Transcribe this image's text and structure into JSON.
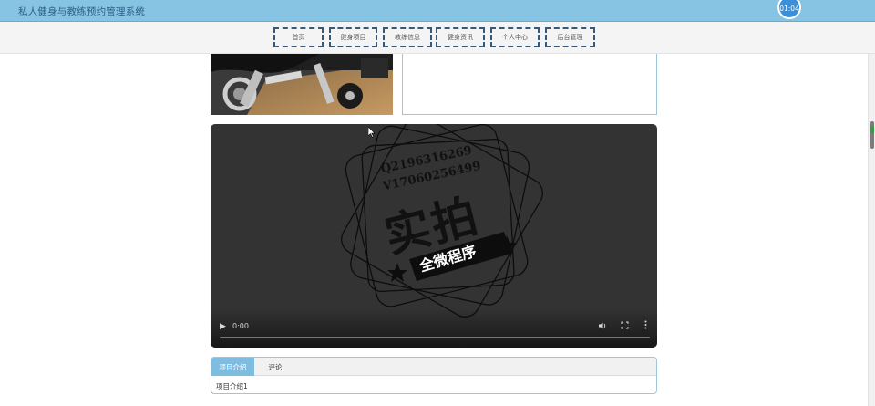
{
  "app": {
    "title": "私人健身与教练预约管理系统",
    "timer": "01:04"
  },
  "nav": {
    "items": [
      {
        "label": "首页"
      },
      {
        "label": "健身项目"
      },
      {
        "label": "教练信息"
      },
      {
        "label": "健身资讯"
      },
      {
        "label": "个人中心"
      },
      {
        "label": "后台管理"
      }
    ]
  },
  "video": {
    "current_time": "0:00",
    "watermark": {
      "line1": "Q2196316269",
      "line2": "V17060256499",
      "big": "实拍",
      "banner": "全微程序"
    }
  },
  "tabs": {
    "items": [
      {
        "label": "项目介绍",
        "active": true
      },
      {
        "label": "评论",
        "active": false
      }
    ],
    "content": "项目介绍1"
  },
  "colors": {
    "header_bg": "#87c3e3",
    "nav_border": "#36597a",
    "tab_active": "#7fbde0"
  }
}
